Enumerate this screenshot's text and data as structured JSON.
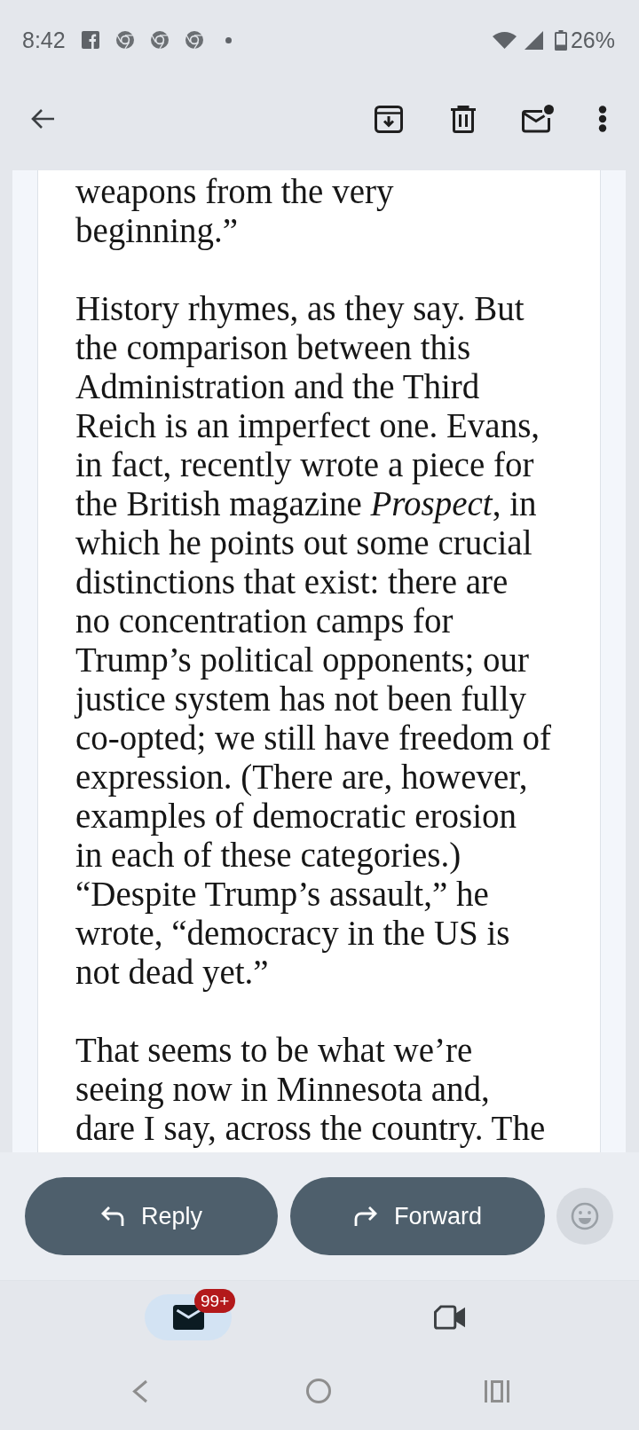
{
  "status_bar": {
    "time": "8:42",
    "battery": "26%"
  },
  "message": {
    "paragraphs": [
      {
        "lines": [
          "weapons from the very",
          "beginning.”"
        ]
      },
      {
        "lines": [
          "History rhymes, as they say. But",
          "the comparison between this",
          "Administration and the Third",
          "Reich is an imperfect one. Evans,",
          "in fact, recently wrote a piece for",
          "the British magazine *Prospect*, in",
          "which he points out some crucial",
          "distinctions that exist: there are",
          "no concentration camps for",
          "Trump’s political opponents; our",
          "justice system has not been fully",
          "co-opted; we still have freedom of",
          "expression. (There are, however,",
          "examples of democratic erosion",
          "in each of these categories.)",
          "“Despite Trump’s assault,” he",
          "wrote, “democracy in the US is",
          "not dead yet.”"
        ]
      },
      {
        "lines": [
          "That seems to be what we’re",
          "seeing now in Minnesota and,",
          "dare I say, across the country. The"
        ]
      }
    ]
  },
  "actions": [
    {
      "kind": "reply",
      "label": "Reply"
    },
    {
      "kind": "forward",
      "label": "Forward"
    }
  ],
  "nav_tabs": [
    {
      "kind": "mail",
      "selected": true,
      "badge": "99+"
    },
    {
      "kind": "video",
      "selected": false
    }
  ]
}
